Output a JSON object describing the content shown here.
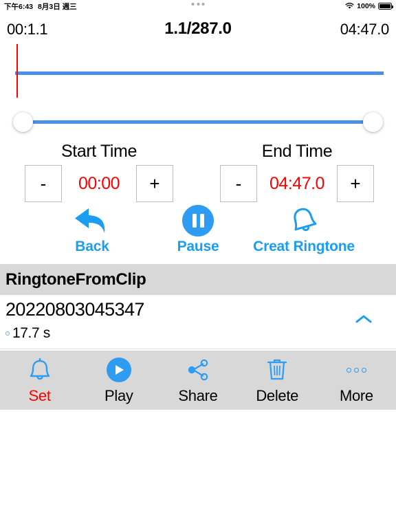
{
  "status_bar": {
    "time": "下午6:43",
    "date": "8月3日 週三",
    "battery_percent": "100%",
    "wifi_icon": "wifi-icon",
    "battery_icon": "battery-full-icon",
    "multitask_handle": "multitask-handle-icon"
  },
  "player": {
    "current_position": "00:1.1",
    "progress_title": "1.1/287.0",
    "total_duration": "04:47.0",
    "waveform_color": "#4a90e8",
    "playhead_color": "#ff0000"
  },
  "trim": {
    "start": {
      "title": "Start Time",
      "value": "00:00",
      "minus_label": "-",
      "plus_label": "+"
    },
    "end": {
      "title": "End Time",
      "value": "04:47.0",
      "minus_label": "-",
      "plus_label": "+"
    },
    "value_color": "#ff0000"
  },
  "actions": [
    {
      "label": "Back",
      "icon": "back-arrow-icon"
    },
    {
      "label": "Pause",
      "icon": "pause-icon"
    },
    {
      "label": "Creat Ringtone",
      "icon": "bell-icon"
    }
  ],
  "section": {
    "header": "RingtoneFromClip"
  },
  "list_item": {
    "title": "20220803045347",
    "duration": "17.7 s",
    "chevron_icon": "chevron-up-icon"
  },
  "toolbar": [
    {
      "label": "Set",
      "icon": "bell-outline-icon",
      "label_color": "#ff0000"
    },
    {
      "label": "Play",
      "icon": "play-icon",
      "label_color": "#000000"
    },
    {
      "label": "Share",
      "icon": "share-icon",
      "label_color": "#000000"
    },
    {
      "label": "Delete",
      "icon": "trash-icon",
      "label_color": "#000000"
    },
    {
      "label": "More",
      "icon": "more-dots-icon",
      "label_color": "#000000"
    }
  ],
  "theme": {
    "accent_blue": "#2f9cf4",
    "link_blue": "#1b9df0",
    "bar_gray": "#d8d8d8",
    "red": "#ff0000"
  }
}
